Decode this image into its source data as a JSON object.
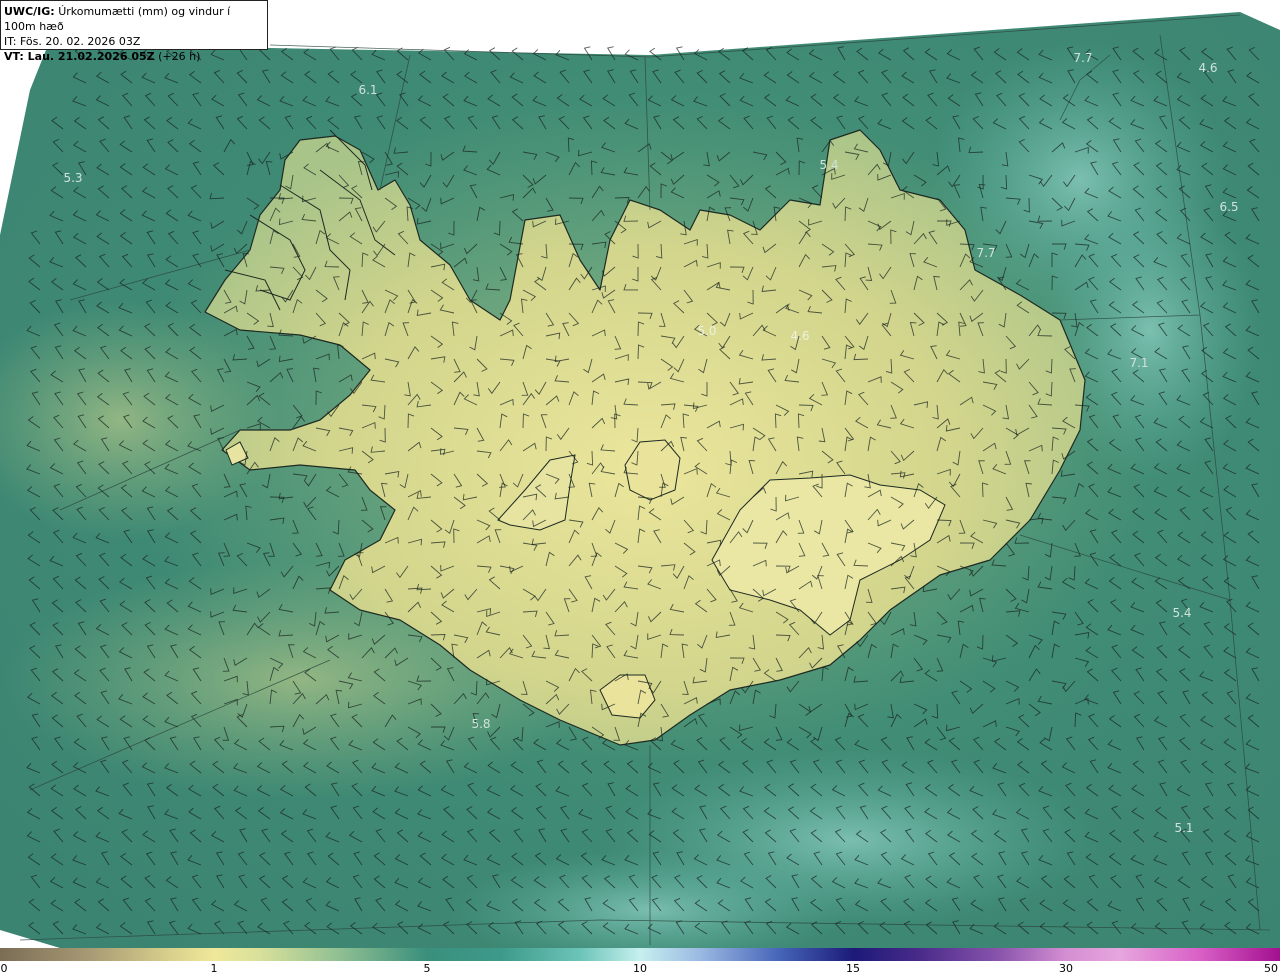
{
  "title": {
    "label": "UWC/IG:",
    "description": "Úrkomumætti (mm) og vindur í 100m hæð",
    "init_time": "IT: Fös. 20. 02. 2026 03Z",
    "valid_label": "VT: Lau. 21.02.2026 05Z",
    "valid_offset": "(+26 h)"
  },
  "map_values": [
    "6.1",
    "5.3",
    "5.4",
    "7.7",
    "4.6",
    "6.5",
    "7.7",
    "7.1",
    "5.0",
    "4.6",
    "5.4",
    "5.8",
    "5.1"
  ],
  "colorbar": {
    "ticks": [
      "0",
      "1",
      "5",
      "10",
      "15",
      "30",
      "50"
    ],
    "colors": [
      "#7b6d55",
      "#efe89a",
      "#3a8f7c",
      "#c6f0ef",
      "#1c1a78",
      "#d48ed2",
      "#a2108f"
    ]
  },
  "colors": {
    "ocean": "#3f8a74",
    "land_low": "#cfd28a",
    "land_high": "#e8e59c",
    "coast": "#1e2a22",
    "barb": "#1a2620"
  }
}
